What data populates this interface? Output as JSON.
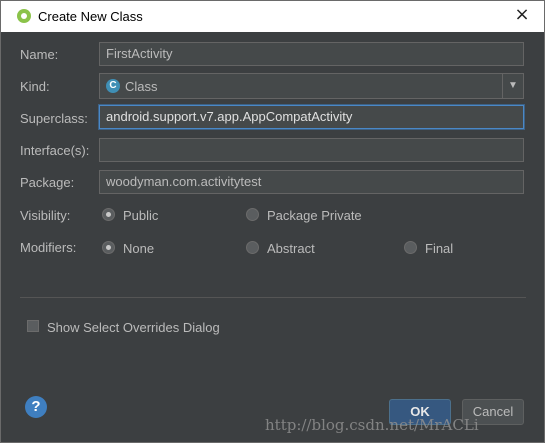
{
  "window": {
    "title": "Create New Class",
    "close_icon": "×"
  },
  "form": {
    "name": {
      "label": "Name:",
      "value": "FirstActivity"
    },
    "kind": {
      "label": "Kind:",
      "value": "Class",
      "icon": "C",
      "dropdown_icon": "▼"
    },
    "superclass": {
      "label": "Superclass:",
      "value": "android.support.v7.app.AppCompatActivity"
    },
    "interfaces": {
      "label": "Interface(s):",
      "value": ""
    },
    "package": {
      "label": "Package:",
      "value": "woodyman.com.activitytest"
    },
    "visibility": {
      "label": "Visibility:",
      "options": [
        "Public",
        "Package Private"
      ],
      "selected": "Public"
    },
    "modifiers": {
      "label": "Modifiers:",
      "options": [
        "None",
        "Abstract",
        "Final"
      ],
      "selected": "None"
    },
    "show_overrides": {
      "label": "Show Select Overrides Dialog",
      "checked": false
    }
  },
  "buttons": {
    "help_icon": "?",
    "ok": "OK",
    "cancel": "Cancel"
  },
  "watermark": "http://blog.csdn.net/MrACLi",
  "colors": {
    "background": "#3c3f41",
    "focus": "#4a88c7",
    "ok_button": "#365880",
    "help_icon": "#3f7fc0"
  }
}
